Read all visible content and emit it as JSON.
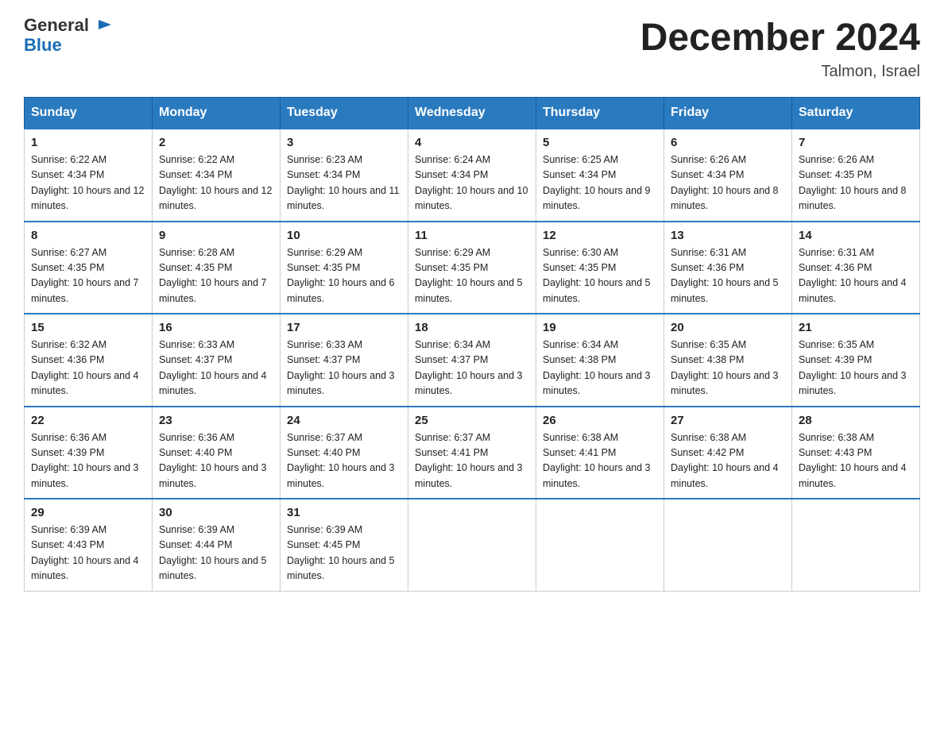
{
  "logo": {
    "text_general": "General",
    "text_blue": "Blue"
  },
  "title": "December 2024",
  "location": "Talmon, Israel",
  "weekdays": [
    "Sunday",
    "Monday",
    "Tuesday",
    "Wednesday",
    "Thursday",
    "Friday",
    "Saturday"
  ],
  "weeks": [
    [
      {
        "day": "1",
        "sunrise": "6:22 AM",
        "sunset": "4:34 PM",
        "daylight": "10 hours and 12 minutes."
      },
      {
        "day": "2",
        "sunrise": "6:22 AM",
        "sunset": "4:34 PM",
        "daylight": "10 hours and 12 minutes."
      },
      {
        "day": "3",
        "sunrise": "6:23 AM",
        "sunset": "4:34 PM",
        "daylight": "10 hours and 11 minutes."
      },
      {
        "day": "4",
        "sunrise": "6:24 AM",
        "sunset": "4:34 PM",
        "daylight": "10 hours and 10 minutes."
      },
      {
        "day": "5",
        "sunrise": "6:25 AM",
        "sunset": "4:34 PM",
        "daylight": "10 hours and 9 minutes."
      },
      {
        "day": "6",
        "sunrise": "6:26 AM",
        "sunset": "4:34 PM",
        "daylight": "10 hours and 8 minutes."
      },
      {
        "day": "7",
        "sunrise": "6:26 AM",
        "sunset": "4:35 PM",
        "daylight": "10 hours and 8 minutes."
      }
    ],
    [
      {
        "day": "8",
        "sunrise": "6:27 AM",
        "sunset": "4:35 PM",
        "daylight": "10 hours and 7 minutes."
      },
      {
        "day": "9",
        "sunrise": "6:28 AM",
        "sunset": "4:35 PM",
        "daylight": "10 hours and 7 minutes."
      },
      {
        "day": "10",
        "sunrise": "6:29 AM",
        "sunset": "4:35 PM",
        "daylight": "10 hours and 6 minutes."
      },
      {
        "day": "11",
        "sunrise": "6:29 AM",
        "sunset": "4:35 PM",
        "daylight": "10 hours and 5 minutes."
      },
      {
        "day": "12",
        "sunrise": "6:30 AM",
        "sunset": "4:35 PM",
        "daylight": "10 hours and 5 minutes."
      },
      {
        "day": "13",
        "sunrise": "6:31 AM",
        "sunset": "4:36 PM",
        "daylight": "10 hours and 5 minutes."
      },
      {
        "day": "14",
        "sunrise": "6:31 AM",
        "sunset": "4:36 PM",
        "daylight": "10 hours and 4 minutes."
      }
    ],
    [
      {
        "day": "15",
        "sunrise": "6:32 AM",
        "sunset": "4:36 PM",
        "daylight": "10 hours and 4 minutes."
      },
      {
        "day": "16",
        "sunrise": "6:33 AM",
        "sunset": "4:37 PM",
        "daylight": "10 hours and 4 minutes."
      },
      {
        "day": "17",
        "sunrise": "6:33 AM",
        "sunset": "4:37 PM",
        "daylight": "10 hours and 3 minutes."
      },
      {
        "day": "18",
        "sunrise": "6:34 AM",
        "sunset": "4:37 PM",
        "daylight": "10 hours and 3 minutes."
      },
      {
        "day": "19",
        "sunrise": "6:34 AM",
        "sunset": "4:38 PM",
        "daylight": "10 hours and 3 minutes."
      },
      {
        "day": "20",
        "sunrise": "6:35 AM",
        "sunset": "4:38 PM",
        "daylight": "10 hours and 3 minutes."
      },
      {
        "day": "21",
        "sunrise": "6:35 AM",
        "sunset": "4:39 PM",
        "daylight": "10 hours and 3 minutes."
      }
    ],
    [
      {
        "day": "22",
        "sunrise": "6:36 AM",
        "sunset": "4:39 PM",
        "daylight": "10 hours and 3 minutes."
      },
      {
        "day": "23",
        "sunrise": "6:36 AM",
        "sunset": "4:40 PM",
        "daylight": "10 hours and 3 minutes."
      },
      {
        "day": "24",
        "sunrise": "6:37 AM",
        "sunset": "4:40 PM",
        "daylight": "10 hours and 3 minutes."
      },
      {
        "day": "25",
        "sunrise": "6:37 AM",
        "sunset": "4:41 PM",
        "daylight": "10 hours and 3 minutes."
      },
      {
        "day": "26",
        "sunrise": "6:38 AM",
        "sunset": "4:41 PM",
        "daylight": "10 hours and 3 minutes."
      },
      {
        "day": "27",
        "sunrise": "6:38 AM",
        "sunset": "4:42 PM",
        "daylight": "10 hours and 4 minutes."
      },
      {
        "day": "28",
        "sunrise": "6:38 AM",
        "sunset": "4:43 PM",
        "daylight": "10 hours and 4 minutes."
      }
    ],
    [
      {
        "day": "29",
        "sunrise": "6:39 AM",
        "sunset": "4:43 PM",
        "daylight": "10 hours and 4 minutes."
      },
      {
        "day": "30",
        "sunrise": "6:39 AM",
        "sunset": "4:44 PM",
        "daylight": "10 hours and 5 minutes."
      },
      {
        "day": "31",
        "sunrise": "6:39 AM",
        "sunset": "4:45 PM",
        "daylight": "10 hours and 5 minutes."
      },
      null,
      null,
      null,
      null
    ]
  ]
}
